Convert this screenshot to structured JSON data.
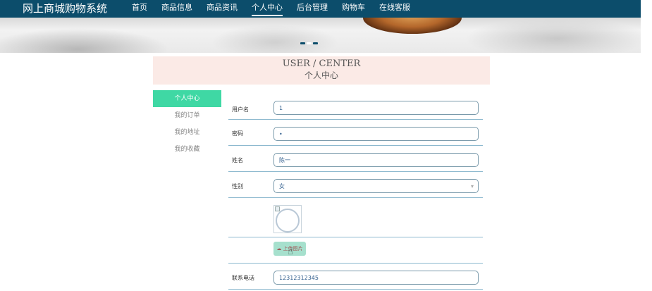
{
  "header": {
    "brand": "网上商城购物系统",
    "nav": [
      "首页",
      "商品信息",
      "商品资讯",
      "个人中心",
      "后台管理",
      "购物车",
      "在线客服"
    ],
    "active_nav": "个人中心"
  },
  "banner": {
    "slide_count": 3,
    "active_slide": 2
  },
  "section": {
    "title_en": "USER / CENTER",
    "title_cn": "个人中心"
  },
  "sidebar": {
    "items": [
      "个人中心",
      "我的订单",
      "我的地址",
      "我的收藏"
    ],
    "active": "个人中心"
  },
  "form": {
    "username_label": "用户名",
    "username_value": "1",
    "password_label": "密码",
    "password_value": "•",
    "name_label": "姓名",
    "name_value": "陈一",
    "gender_label": "性别",
    "gender_value": "女",
    "upload_label": "上传图片",
    "phone_label": "联系电话",
    "phone_value": "12312312345"
  },
  "colors": {
    "nav_bg": "#0c4d6b",
    "sidebar_active": "#3fd8a4",
    "header_box_bg": "#fbeae6",
    "row_divider": "#8db9cf",
    "upload_button": "#a6e0cd"
  }
}
